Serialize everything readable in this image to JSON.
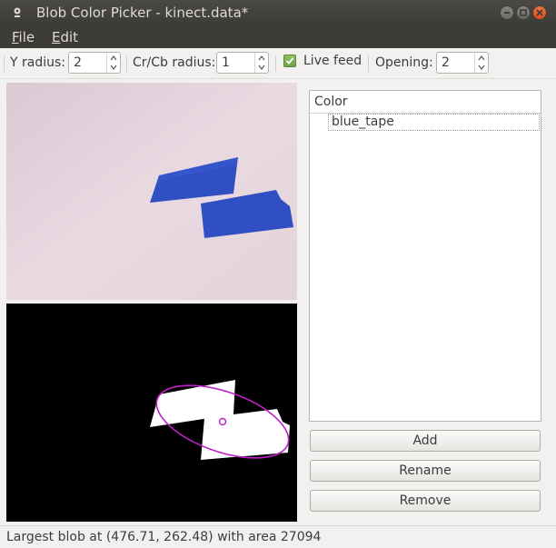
{
  "window": {
    "title": "Blob Color Picker - kinect.data*",
    "icons": {
      "app": "webcam-icon",
      "minimize": "minimize-icon",
      "maximize": "maximize-icon",
      "close": "close-icon"
    }
  },
  "menu": {
    "items": [
      {
        "mnemonic": "F",
        "rest": "ile"
      },
      {
        "mnemonic": "E",
        "rest": "dit"
      }
    ]
  },
  "toolbar": {
    "y_radius_label": "Y radius:",
    "y_radius_value": "2",
    "crcb_radius_label": "Cr/Cb radius:",
    "crcb_radius_value": "1",
    "live_feed_label": "Live feed",
    "live_feed_checked": true,
    "opening_label": "Opening:",
    "opening_value": "2"
  },
  "color_list": {
    "header": "Color",
    "items": [
      "blue_tape"
    ]
  },
  "buttons": {
    "add": "Add",
    "rename": "Rename",
    "remove": "Remove"
  },
  "status": {
    "text": "Largest blob at (476.71, 262.48) with area 27094"
  },
  "colors": {
    "titlebar_bg": "#3c3b37",
    "tape_blue": "#2f4fc2",
    "ellipse": "#c01ec8",
    "check_green": "#7ab350"
  }
}
